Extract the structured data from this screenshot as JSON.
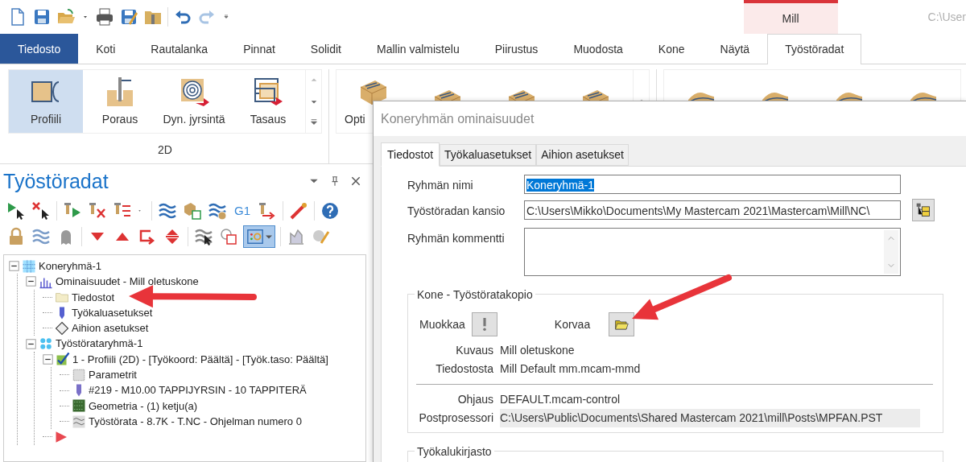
{
  "context_tab": {
    "label": "Mill"
  },
  "window_path": "C:\\User",
  "tabs": [
    {
      "label": "Tiedosto",
      "kind": "file",
      "selected": false
    },
    {
      "label": "Koti",
      "selected": false
    },
    {
      "label": "Rautalanka",
      "selected": false
    },
    {
      "label": "Pinnat",
      "selected": false
    },
    {
      "label": "Solidit",
      "selected": false
    },
    {
      "label": "Mallin valmistelu",
      "selected": false
    },
    {
      "label": "Piirustus",
      "selected": false
    },
    {
      "label": "Muodosta",
      "selected": false
    },
    {
      "label": "Kone",
      "selected": false
    },
    {
      "label": "Näytä",
      "selected": false
    },
    {
      "label": "Työstöradat",
      "selected": true
    }
  ],
  "ribbon": {
    "groups": [
      {
        "label": "2D",
        "buttons": [
          {
            "label": "Profiili",
            "kind": "profile",
            "selected": true
          },
          {
            "label": "Poraus",
            "kind": "drill",
            "selected": false
          },
          {
            "label": "Dyn. jyrsintä",
            "kind": "dynamic",
            "selected": false
          },
          {
            "label": "Tasaus",
            "kind": "offset",
            "selected": false
          }
        ]
      },
      {
        "buttons": [
          {
            "label": "Opti",
            "kind": "block",
            "selected": false
          },
          {
            "kind": "block",
            "selected": false
          },
          {
            "kind": "block",
            "selected": false
          },
          {
            "kind": "block",
            "selected": false
          }
        ]
      },
      {
        "buttons": [
          {
            "kind": "surface",
            "selected": false
          },
          {
            "kind": "surface",
            "selected": false
          },
          {
            "kind": "surface",
            "selected": false
          },
          {
            "kind": "surface",
            "selected": false
          }
        ]
      }
    ]
  },
  "panel": {
    "title": "Työstöradat",
    "toolbar_text": "G1",
    "display_toggle": {
      "selected": true
    },
    "tree": [
      {
        "label": "Koneryhmä-1",
        "kind": "machine-group",
        "expanded": true,
        "children": [
          {
            "label": "Ominaisuudet - Mill oletuskone",
            "kind": "properties",
            "expanded": true,
            "children": [
              {
                "label": "Tiedostot",
                "kind": "files"
              },
              {
                "label": "Työkaluasetukset",
                "kind": "tool-settings"
              },
              {
                "label": "Aihion asetukset",
                "kind": "stock"
              }
            ]
          },
          {
            "label": "Työstörataryhmä-1",
            "kind": "toolpath-group",
            "expanded": true,
            "children": [
              {
                "label": "1 - Profiili (2D) - [Työkoord: Päältä] - [Työk.taso: Päältä]",
                "kind": "operation",
                "expanded": true,
                "children": [
                  {
                    "label": "Parametrit",
                    "kind": "parameters"
                  },
                  {
                    "label": "#219 - M10.00 TAPPIJYRSIN - 10 TAPPITERÄ",
                    "kind": "tool"
                  },
                  {
                    "label": "Geometria - (1) ketju(a)",
                    "kind": "geometry"
                  },
                  {
                    "label": "Työstörata - 8.7K - T.NC - Ohjelman numero 0",
                    "kind": "toolpath"
                  }
                ]
              },
              {
                "kind": "insert-marker"
              }
            ]
          }
        ]
      }
    ]
  },
  "dialog": {
    "title": "Koneryhmän ominaisuudet",
    "tabs": [
      {
        "label": "Tiedostot",
        "selected": true
      },
      {
        "label": "Työkaluasetukset",
        "selected": false
      },
      {
        "label": "Aihion asetukset",
        "selected": false
      }
    ],
    "fields": [
      {
        "label": "Ryhmän nimi",
        "kind": "text",
        "value": "Koneryhmä-1",
        "text_selected": true
      },
      {
        "label": "Työstöradan kansio",
        "kind": "path",
        "value": "C:\\Users\\Mikko\\Documents\\My Mastercam 2021\\Mastercam\\Mill\\NC\\"
      },
      {
        "label": "Ryhmän kommentti",
        "kind": "multiline"
      }
    ],
    "machine_section": {
      "title": "Kone - Työstöratakopio",
      "edit_label": "Muokkaa",
      "replace_label": "Korvaa",
      "info": [
        {
          "label": "Kuvaus",
          "value": "Mill oletuskone"
        },
        {
          "label": "Tiedostosta",
          "value": "Mill Default mm.mcam-mmd"
        }
      ],
      "control": [
        {
          "label": "Ohjaus",
          "value": "DEFAULT.mcam-control"
        },
        {
          "label": "Postprosessori",
          "value": "C:\\Users\\Public\\Documents\\Shared Mastercam 2021\\mill\\Posts\\MPFAN.PST",
          "kind": "readonly"
        }
      ]
    },
    "tool_library": {
      "title": "Työkalukirjasto"
    }
  },
  "annotations": [
    {
      "kind": "arrow"
    },
    {
      "kind": "arrow"
    }
  ]
}
